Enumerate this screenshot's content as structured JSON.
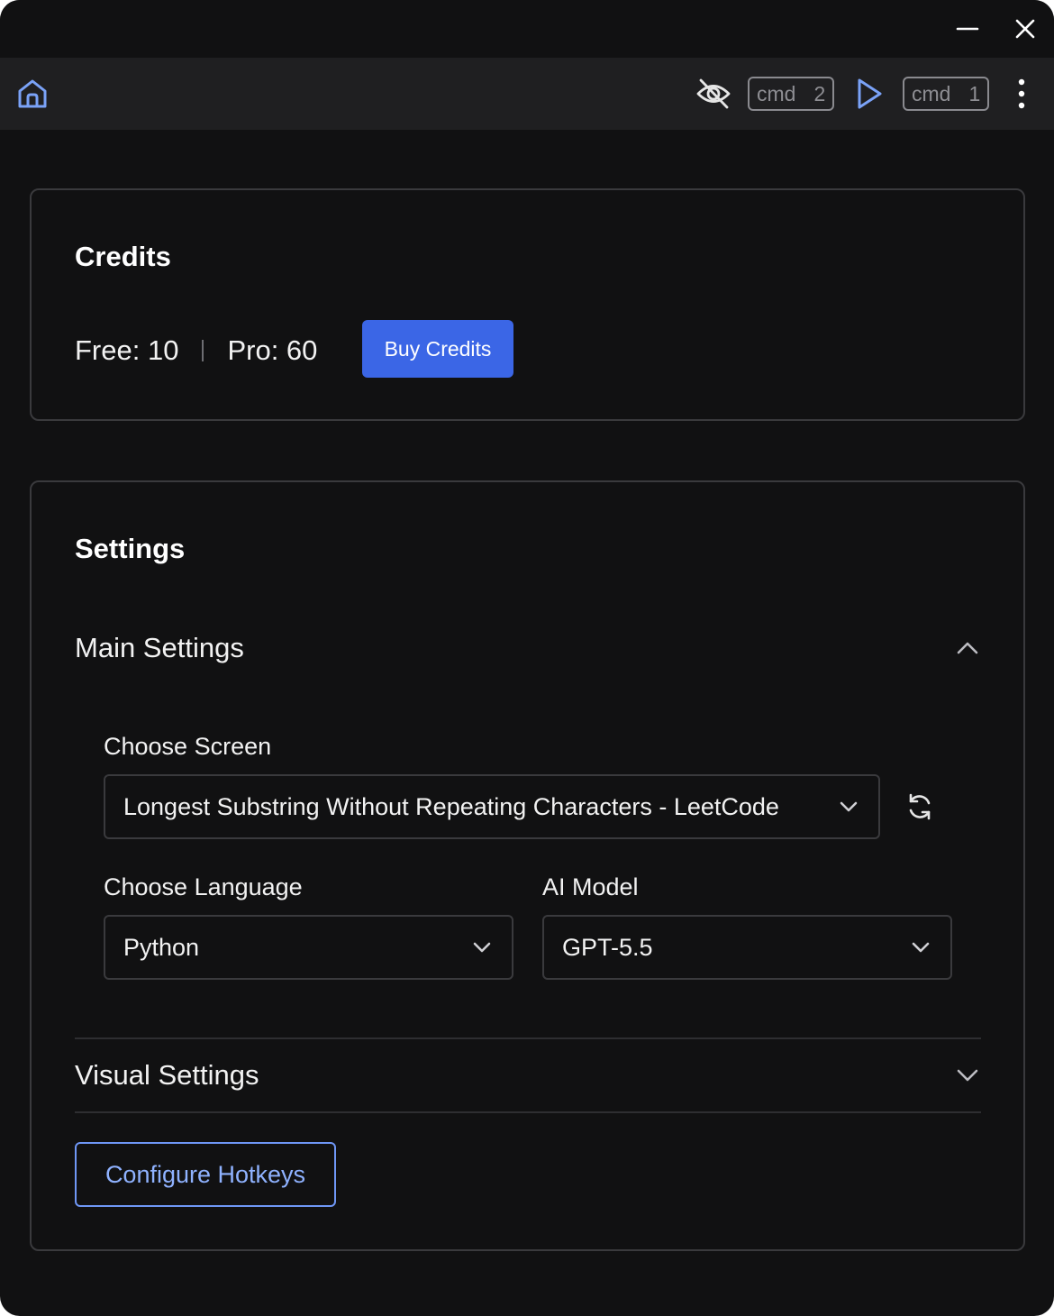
{
  "window": {
    "minimize_icon": "minus-icon",
    "close_icon": "close-icon"
  },
  "toolbar": {
    "home_icon": "home-icon",
    "hide_icon": "eye-off-icon",
    "hide_shortcut": {
      "modifier": "cmd",
      "key": "2"
    },
    "run_icon": "play-icon",
    "run_shortcut": {
      "modifier": "cmd",
      "key": "1"
    },
    "more_icon": "more-vertical-icon"
  },
  "credits": {
    "title": "Credits",
    "free": "Free: 10",
    "pro": "Pro: 60",
    "buy_label": "Buy Credits"
  },
  "settings": {
    "title": "Settings",
    "main_section": {
      "label": "Main Settings",
      "expanded": true,
      "choose_screen": {
        "label": "Choose Screen",
        "value": "Longest Substring Without Repeating Characters - LeetCode"
      },
      "choose_language": {
        "label": "Choose Language",
        "value": "Python"
      },
      "ai_model": {
        "label": "AI Model",
        "value": "GPT-5.5"
      }
    },
    "visual_section": {
      "label": "Visual Settings",
      "expanded": false
    },
    "hotkeys_label": "Configure Hotkeys"
  },
  "colors": {
    "background": "#111112",
    "toolbar": "#1f1f21",
    "accent": "#3b66e6",
    "accent_outline": "#6f97f6",
    "icon_blue": "#7aa2f7"
  }
}
